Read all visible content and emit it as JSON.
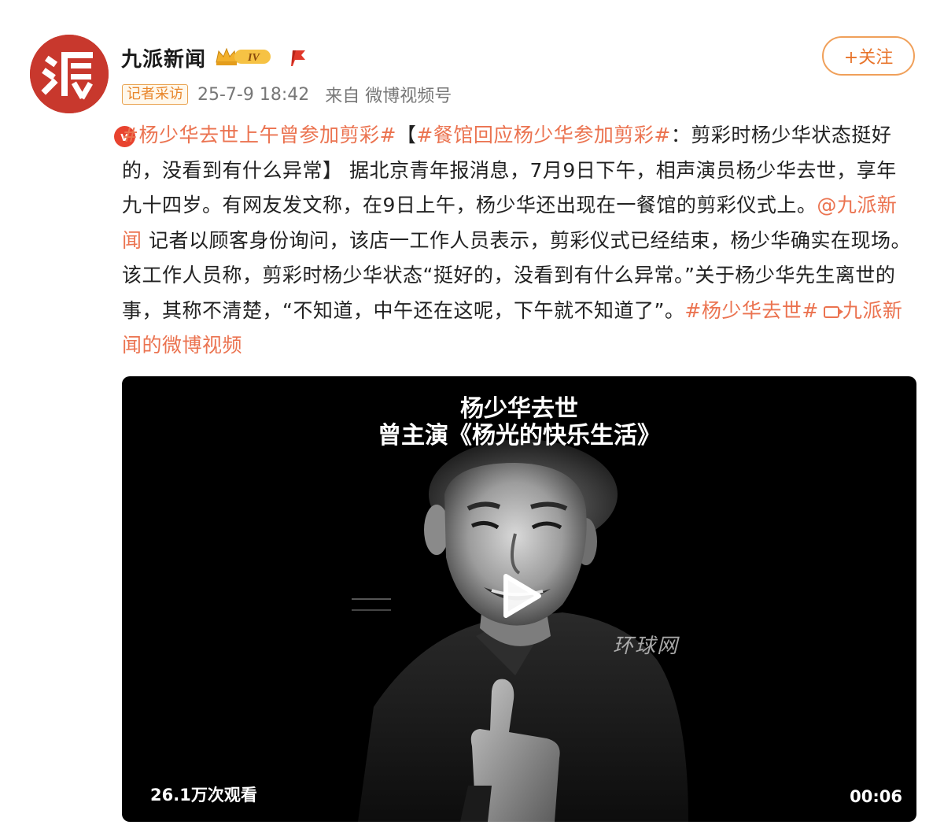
{
  "header": {
    "username": "九派新闻",
    "level_badge": "IV",
    "verified_mark": "v",
    "follow_label": "+关注",
    "tag": "记者采访",
    "time": "25-7-9 18:42",
    "source": "来自 微博视频号"
  },
  "post": {
    "segments": [
      {
        "text": "#杨少华去世上午曾参加剪彩#",
        "type": "link"
      },
      {
        "text": "【",
        "type": "plain"
      },
      {
        "text": "#餐馆回应杨少华参加剪彩#",
        "type": "link"
      },
      {
        "text": "：剪彩时杨少华状态挺好的，没看到有什么异常】 据北京青年报消息，7月9日下午，相声演员杨少华去世，享年九十四岁。有网友发文称，在9日上午，杨少华还出现在一餐馆的剪彩仪式上。",
        "type": "plain"
      },
      {
        "text": "@九派新闻",
        "type": "link"
      },
      {
        "text": " 记者以顾客身份询问，该店一工作人员表示，剪彩仪式已经结束，杨少华确实在现场。该工作人员称，剪彩时杨少华状态“挺好的，没看到有什么异常。”关于杨少华先生离世的事，其称不清楚，“不知道，中午还在这呢，下午就不知道了”。",
        "type": "plain"
      },
      {
        "text": "#杨少华去世#",
        "type": "link"
      },
      {
        "text": "九派新闻的微博视频",
        "type": "video-link"
      }
    ]
  },
  "video": {
    "title_line1": "杨少华去世",
    "title_line2": "曾主演《杨光的快乐生活》",
    "watermark": "环球网",
    "view_count": "26.1万次观看",
    "duration": "00:06"
  },
  "colors": {
    "link": "#eb7350",
    "brand_red": "#c8382d",
    "follow_orange": "#e8742b",
    "tag_orange": "#e8862b"
  },
  "icons": {
    "avatar": "jiupai-logo-avatar",
    "verified": "verified-v-icon",
    "crown": "crown-icon",
    "flag": "red-flag-icon",
    "play": "play-icon",
    "video_link": "video-link-icon"
  }
}
